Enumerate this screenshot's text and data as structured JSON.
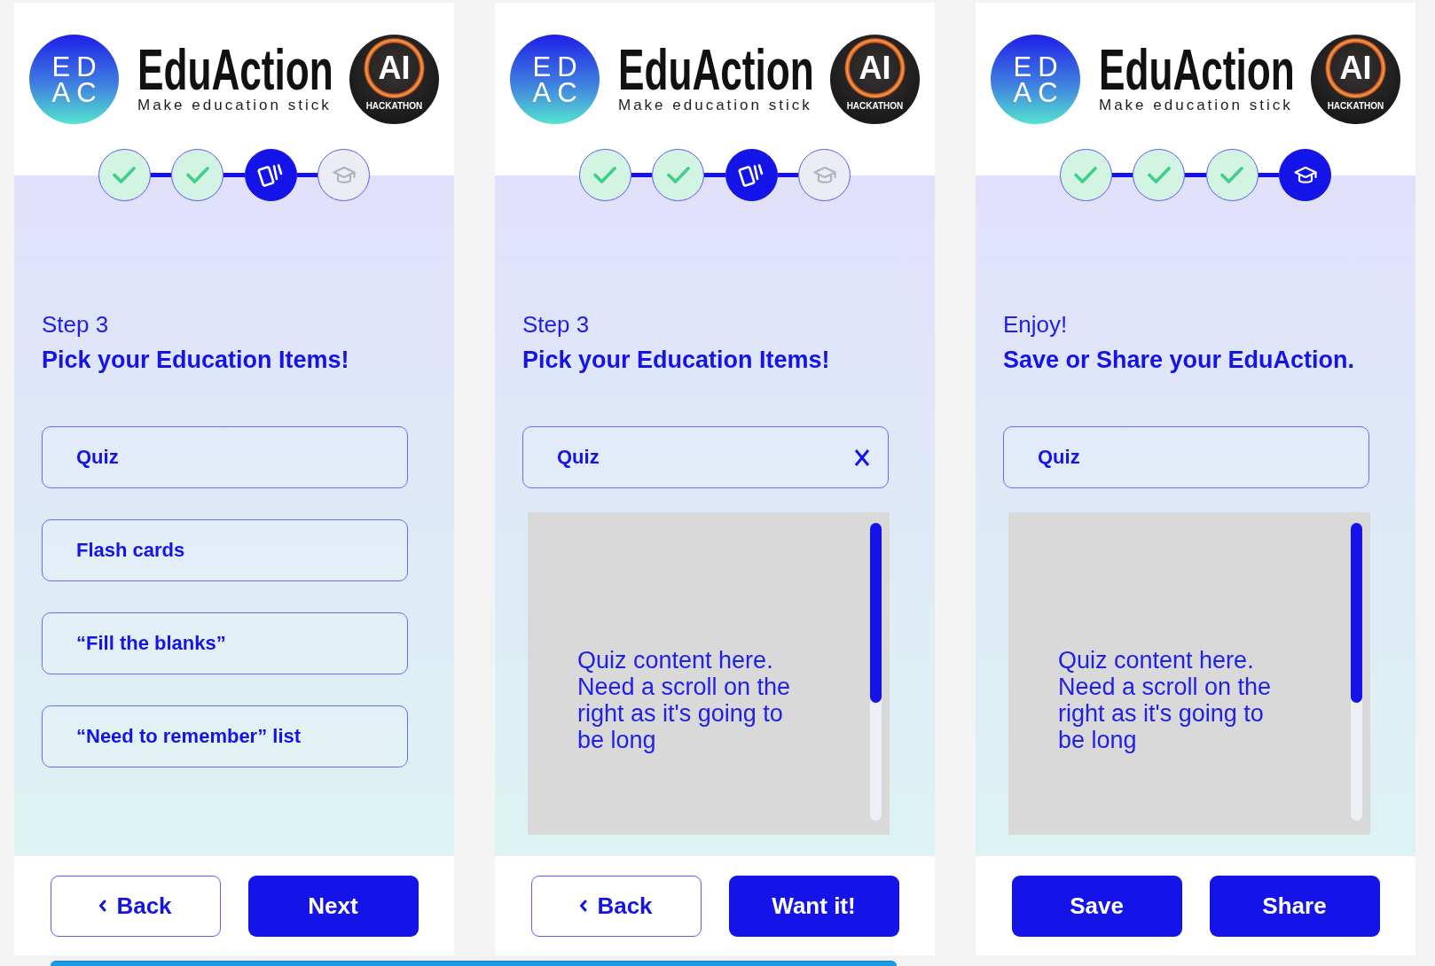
{
  "panels": [
    {
      "header": {
        "logo_mark": [
          "ED",
          "AC"
        ],
        "title": "EduAction",
        "tagline": "Make education stick",
        "badge": {
          "mark": "AI",
          "label": "HACKATHON"
        }
      },
      "steps": [
        {
          "done": true,
          "selected": false
        },
        {
          "done": true,
          "selected": false
        },
        {
          "done": false,
          "selected": true
        },
        {
          "done": false,
          "selected": false
        }
      ],
      "step_label": "Step 3",
      "heading": "Pick your Education Items!",
      "items": [
        {
          "label": "Quiz",
          "removable": false
        },
        {
          "label": "Flash cards",
          "removable": false
        },
        {
          "label": "“Fill the blanks”",
          "removable": false
        },
        {
          "label": "“Need to remember” list",
          "removable": false
        }
      ],
      "buttons": [
        {
          "label": "Back",
          "kind": "back"
        },
        {
          "label": "Next",
          "kind": "primary"
        }
      ]
    },
    {
      "header": {
        "logo_mark": [
          "ED",
          "AC"
        ],
        "title": "EduAction",
        "tagline": "Make education stick",
        "badge": {
          "mark": "AI",
          "label": "HACKATHON"
        }
      },
      "steps": [
        {
          "done": true,
          "selected": false
        },
        {
          "done": true,
          "selected": false
        },
        {
          "done": false,
          "selected": true
        },
        {
          "done": false,
          "selected": false
        }
      ],
      "step_label": "Step 3",
      "heading": "Pick your Education Items!",
      "items": [
        {
          "label": "Quiz",
          "removable": true
        }
      ],
      "content": {
        "text": "Quiz content here. Need a scroll on the right as it's going to be long"
      },
      "buttons": [
        {
          "label": "Back",
          "kind": "back"
        },
        {
          "label": "Want it!",
          "kind": "primary"
        }
      ]
    },
    {
      "header": {
        "logo_mark": [
          "ED",
          "AC"
        ],
        "title": "EduAction",
        "tagline": "Make education stick",
        "badge": {
          "mark": "AI",
          "label": "HACKATHON"
        }
      },
      "steps": [
        {
          "done": true,
          "selected": false
        },
        {
          "done": true,
          "selected": false
        },
        {
          "done": true,
          "selected": false
        },
        {
          "done": false,
          "selected": true
        }
      ],
      "step_label": "Enjoy!",
      "heading": "Save or Share your EduAction.",
      "items": [
        {
          "label": "Quiz",
          "removable": false
        }
      ],
      "content": {
        "text": "Quiz content here. Need a scroll on the right as it's going to be long"
      },
      "buttons": [
        {
          "label": "Save",
          "kind": "primary"
        },
        {
          "label": "Share",
          "kind": "primary"
        }
      ]
    }
  ]
}
